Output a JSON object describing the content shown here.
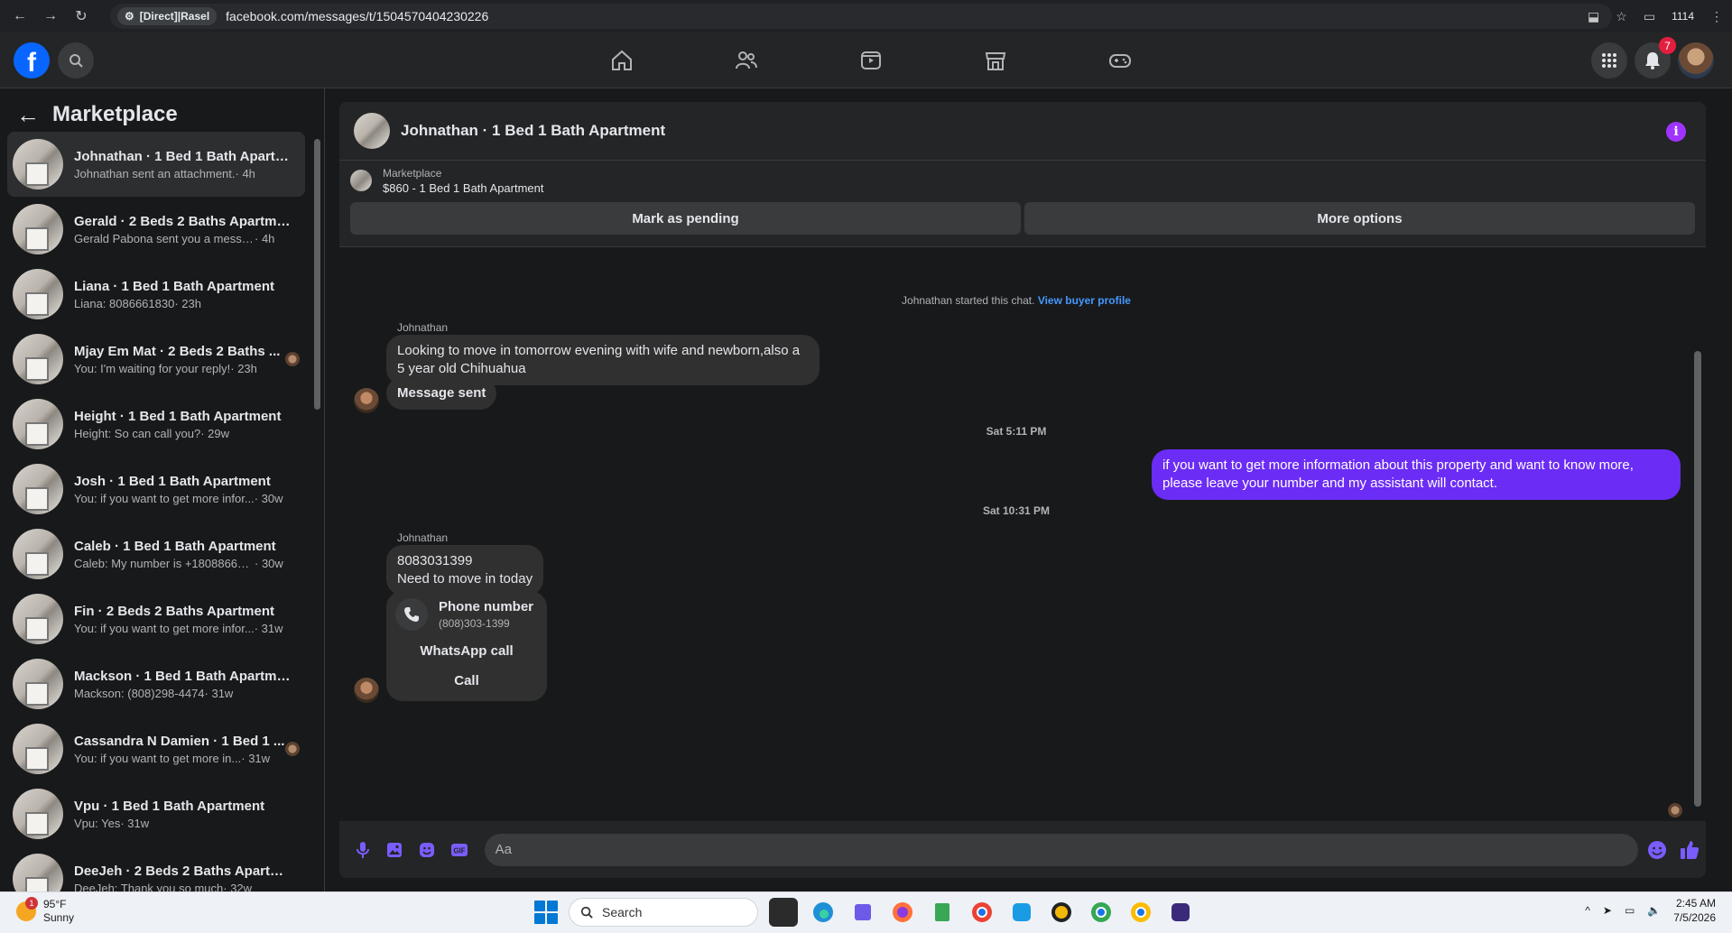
{
  "browser": {
    "site_chip": "[Direct]|Rasel",
    "url": "facebook.com/messages/t/1504570404230226",
    "profile_label": "1114"
  },
  "fb": {
    "notifications_count": "7"
  },
  "sidebar": {
    "title": "Marketplace",
    "conversations": [
      {
        "title": "Johnathan · 1 Bed 1 Bath Apartm...",
        "preview": "Johnathan sent an attachment.",
        "time": " · 4h",
        "active": true
      },
      {
        "title": "Gerald · 2 Beds 2 Baths Apartme...",
        "preview": "Gerald Pabona sent you a message ...",
        "time": " · 4h"
      },
      {
        "title": "Liana · 1 Bed 1 Bath Apartment",
        "preview": "Liana: 8086661830",
        "time": " · 23h"
      },
      {
        "title": "Mjay Em Mat · 2 Beds 2 Baths ...",
        "preview": "You: I'm waiting for your reply!",
        "time": " · 23h",
        "seen": true
      },
      {
        "title": "Height · 1 Bed 1 Bath Apartment",
        "preview": "Height: So can call you?",
        "time": " · 29w"
      },
      {
        "title": "Josh · 1 Bed 1 Bath Apartment",
        "preview": "You: if you want to get more infor...",
        "time": " · 30w"
      },
      {
        "title": "Caleb · 1 Bed 1 Bath Apartment",
        "preview": "Caleb: My number is +180886600...",
        "time": " · 30w"
      },
      {
        "title": "Fin · 2 Beds 2 Baths Apartment",
        "preview": "You: if you want to get more infor...",
        "time": " · 31w"
      },
      {
        "title": "Mackson · 1 Bed 1 Bath Apartment",
        "preview": "Mackson: (808)298-4474",
        "time": " · 31w"
      },
      {
        "title": "Cassandra N Damien · 1 Bed 1 ...",
        "preview": "You: if you want to get more in...",
        "time": " · 31w",
        "seen": true
      },
      {
        "title": "Vpu · 1 Bed 1 Bath Apartment",
        "preview": "Vpu: Yes",
        "time": " · 31w"
      },
      {
        "title": "DeeJeh · 2 Beds 2 Baths Apartm...",
        "preview": "DeeJeh: Thank you so much",
        "time": " · 32w"
      }
    ]
  },
  "chat": {
    "title": "Johnathan · 1 Bed 1 Bath Apartment",
    "listing_source": "Marketplace",
    "listing_title": "$860 - 1 Bed 1 Bath Apartment",
    "mark_pending": "Mark as pending",
    "more_options": "More options",
    "started_text": "Johnathan started this chat.",
    "view_profile": "View buyer profile",
    "sender_name": "Johnathan",
    "msg1": "Looking to move in tomorrow evening with wife and newborn,also  a 5 year old Chihuahua",
    "msg2": "Message sent",
    "ts1": "Sat 5:11 PM",
    "out_msg": "if you want to get more information about this property and want to know more, please leave your number and my assistant will contact.",
    "ts2": "Sat 10:31 PM",
    "sender_name2": "Johnathan",
    "msg3_line1": "8083031399",
    "msg3_line2": "Need to move in today",
    "phone_card": {
      "title": "Phone number",
      "number": "(808)303-1399",
      "whatsapp": "WhatsApp call",
      "call": "Call"
    },
    "composer_placeholder": "Aa"
  },
  "taskbar": {
    "temp": "95°F",
    "condition": "Sunny",
    "weather_badge": "1",
    "search_label": "Search",
    "time": "2:45 AM",
    "date": "7/5/2026"
  }
}
